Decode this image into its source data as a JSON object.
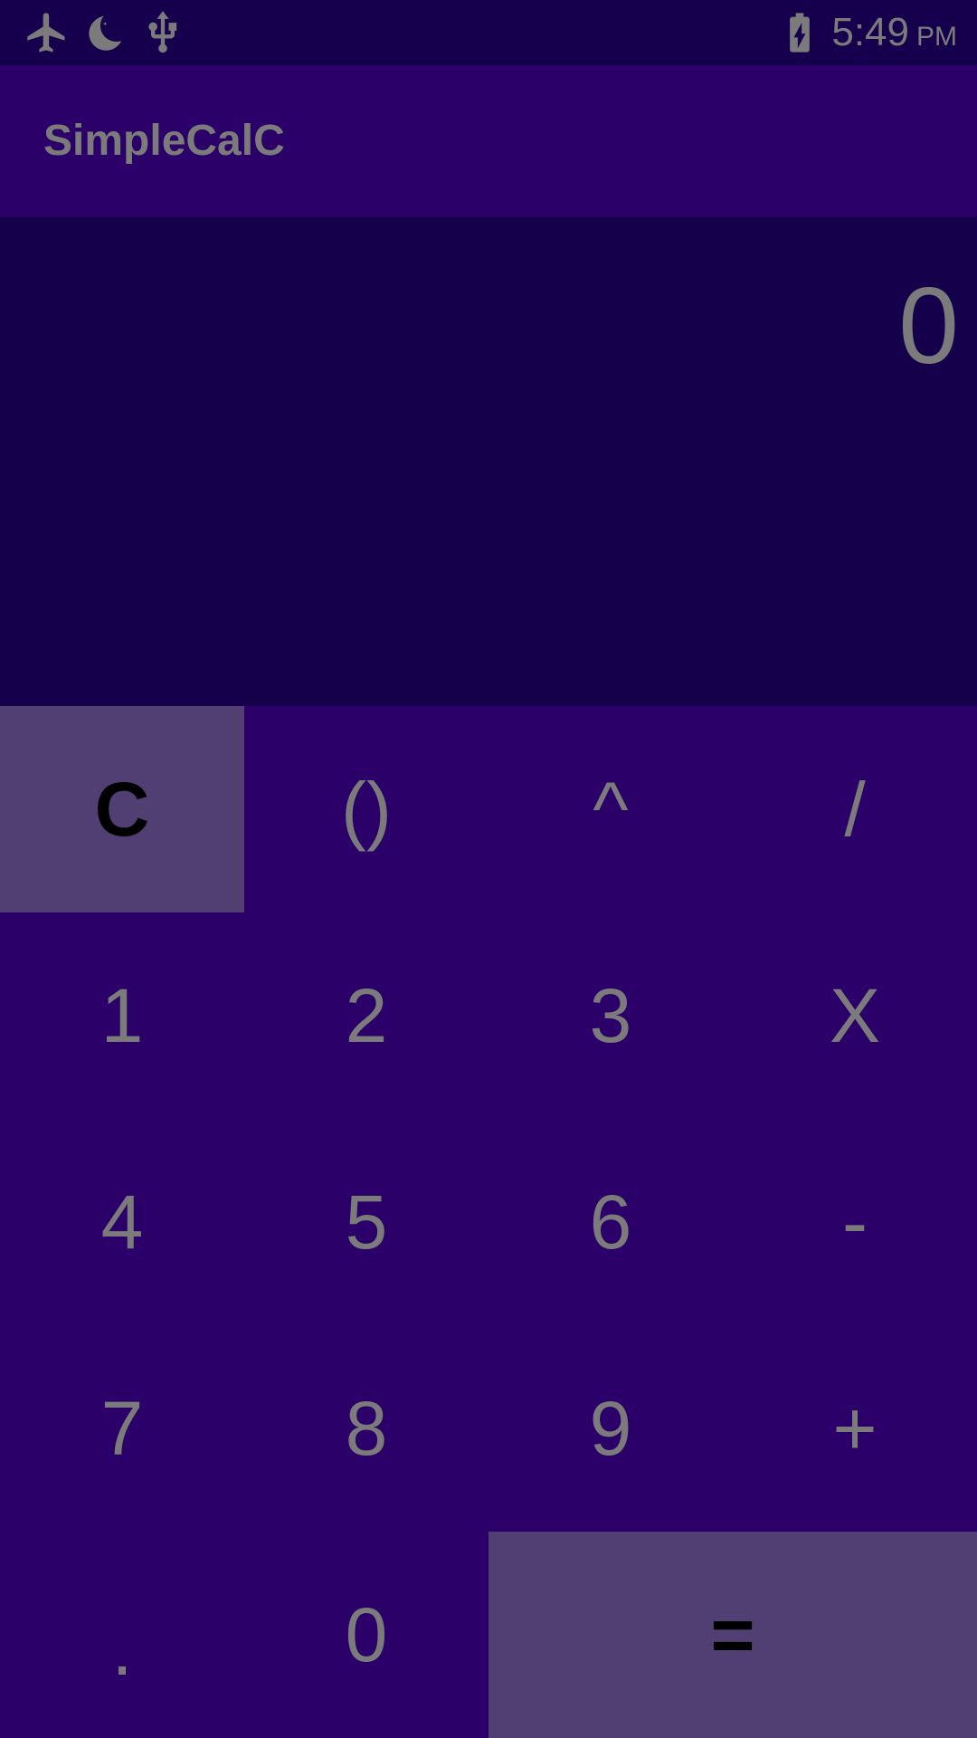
{
  "status_bar": {
    "time": "5:49",
    "ampm": "PM",
    "icons": [
      "airplane-mode-icon",
      "do-not-disturb-moon-icon",
      "usb-icon",
      "battery-charging-icon"
    ]
  },
  "app_bar": {
    "title": "SimpleCalC"
  },
  "display": {
    "value": "0"
  },
  "keypad": {
    "rows": [
      [
        "C",
        "()",
        "^",
        "/"
      ],
      [
        "1",
        "2",
        "3",
        "X"
      ],
      [
        "4",
        "5",
        "6",
        "-"
      ],
      [
        "7",
        "8",
        "9",
        "+"
      ],
      [
        ".",
        "0",
        "="
      ]
    ]
  },
  "colors": {
    "status_bar": "#16004d",
    "app_bar": "#2b0068",
    "display": "#15004c",
    "keypad": "#2b0068",
    "highlight_key": "#513f73",
    "text": "#7b7b7b",
    "highlight_text": "#000000"
  }
}
